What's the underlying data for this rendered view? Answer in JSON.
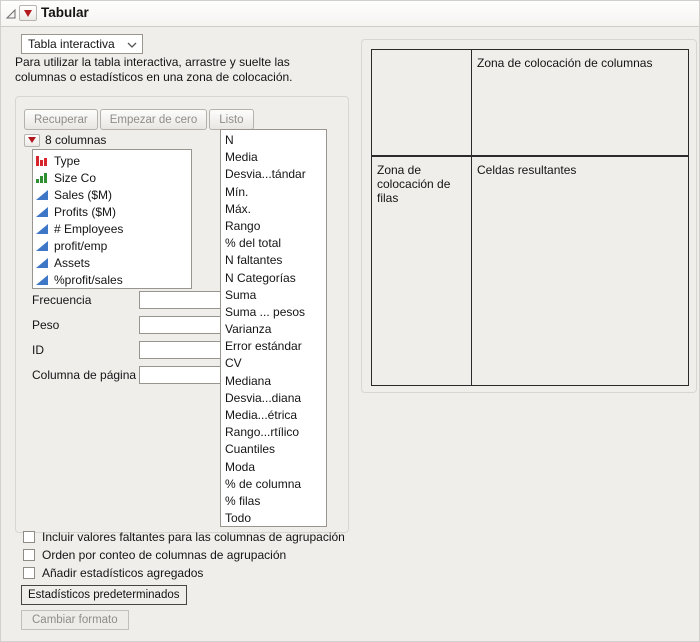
{
  "header": {
    "title": "Tabular"
  },
  "toolbar": {
    "mode_select": "Tabla interactiva",
    "instructions": [
      "Para utilizar la tabla interactiva, arrastre y suelte las",
      "columnas o estadísticos en una zona de colocación."
    ]
  },
  "control_panel": {
    "buttons": [
      {
        "label": "Recuperar",
        "state": "disabled"
      },
      {
        "label": "Empezar de cero",
        "state": "disabled"
      },
      {
        "label": "Listo",
        "state": "disabled"
      }
    ],
    "columns_title": "8 columnas",
    "columns": [
      {
        "name": "Type",
        "type": "nominal"
      },
      {
        "name": "Size Co",
        "type": "ordinal"
      },
      {
        "name": "Sales ($M)",
        "type": "continuous"
      },
      {
        "name": "Profits ($M)",
        "type": "continuous"
      },
      {
        "name": "# Employees",
        "type": "continuous"
      },
      {
        "name": "profit/emp",
        "type": "continuous"
      },
      {
        "name": "Assets",
        "type": "continuous"
      },
      {
        "name": "%profit/sales",
        "type": "continuous"
      }
    ],
    "role_fields": [
      {
        "label": "Frecuencia",
        "value": ""
      },
      {
        "label": "Peso",
        "value": ""
      },
      {
        "label": "ID",
        "value": ""
      },
      {
        "label": "Columna de página",
        "value": ""
      }
    ],
    "statistics": [
      "N",
      "Media",
      "Desvia...tándar",
      "Mín.",
      "Máx.",
      "Rango",
      "% del total",
      "N faltantes",
      "N Categorías",
      "Suma",
      "Suma ... pesos",
      "Varianza",
      "Error estándar",
      "CV",
      "Mediana",
      "Desvia...diana",
      "Media...étrica",
      "Rango...rtílico",
      "Cuantiles",
      "Moda",
      "% de columna",
      "% filas",
      "Todo"
    ]
  },
  "options": {
    "checkboxes": [
      {
        "label": "Incluir valores faltantes para las columnas de agrupación",
        "checked": false
      },
      {
        "label": "Orden por conteo de columnas de agrupación",
        "checked": false
      },
      {
        "label": "Añadir estadísticos agregados",
        "checked": false
      }
    ],
    "default_stats_button": "Estadísticos predeterminados",
    "change_format_button": "Cambiar formato"
  },
  "drop_zones": {
    "columns": "Zona de colocación de columnas",
    "rows": "Zona de colocación de filas",
    "cells": "Celdas resultantes"
  },
  "colors": {
    "red_triangle": "#b3191c",
    "continuous_blue": "#3f77c7",
    "ordinal_green": "#2e8f31",
    "nominal_red": "#d6262b"
  }
}
